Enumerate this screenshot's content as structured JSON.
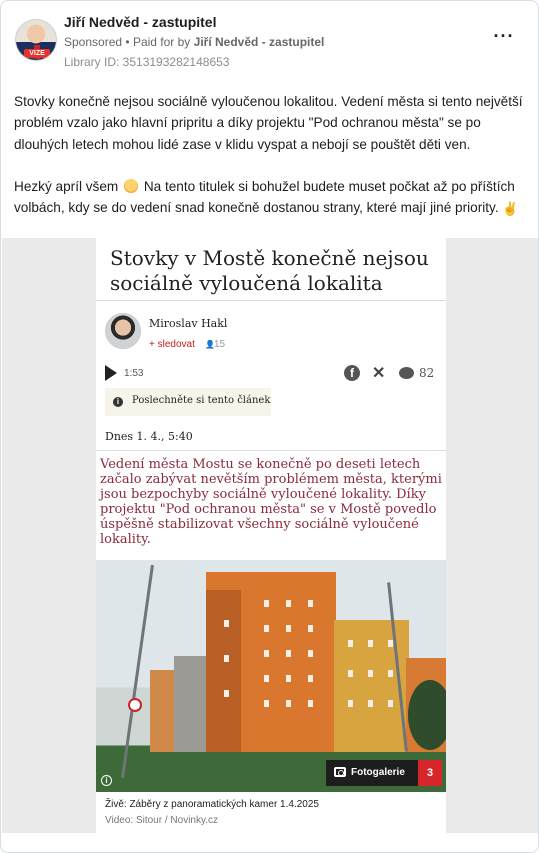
{
  "post": {
    "page_name": "Jiří Nedvěd - zastupitel",
    "sponsored_label": "Sponsored",
    "paid_for_prefix": "Paid for by",
    "paid_for_name": "Jiří Nedvěd - zastupitel",
    "library_id": "Library ID: 3513193282148653",
    "more_icon": "more-horizontal-icon",
    "avatar_badge": "VIZE",
    "paragraph_1": "Stovky konečně nejsou sociálně vyloučenou lokalitou. Vedení města si tento největší problém vzalo jako hlavní pripritu a díky projektu \"Pod ochranou města\" se po dlouhých letech mohou lidé zase v klidu vyspat a nebojí se pouštět děti ven.",
    "paragraph_2_a": "Hezký apríl všem",
    "paragraph_2_b": "Na tento titulek si bohužel budete muset počkat až po příštích volbách, kdy se do vedení snad konečně dostanou strany, které mají jiné priority."
  },
  "article": {
    "title": "Stovky v Mostě konečně nejsou sociálně vyloučená lokalita",
    "author_name": "Miroslav Hakl",
    "follow_label": "+ sledovat",
    "follower_count": "15",
    "duration": "1:53",
    "comment_count": "82",
    "listen_label": "Poslechněte si tento článek",
    "date": "Dnes 1. 4., 5:40",
    "lead": "Vedení města Mostu se konečně po deseti letech začalo zabývat nevětším problémem města, kterými jsou bezpochyby sociálně vyloučené lokality. Díky projektu \"Pod ochranou města\" se v Mostě povedlo úspěšně stabilizovat všechny sociálně vyloučené lokality.",
    "gallery_label": "Fotogalerie",
    "gallery_count": "3",
    "caption": "Živě: Záběry z panoramatických kamer 1.4.2025",
    "caption_source": "Video: Sitour / Novinky.cz"
  },
  "colors": {
    "lead_text": "#8a2b3c",
    "follow": "#c81e1e",
    "gallery_count_bg": "#d7262a"
  }
}
